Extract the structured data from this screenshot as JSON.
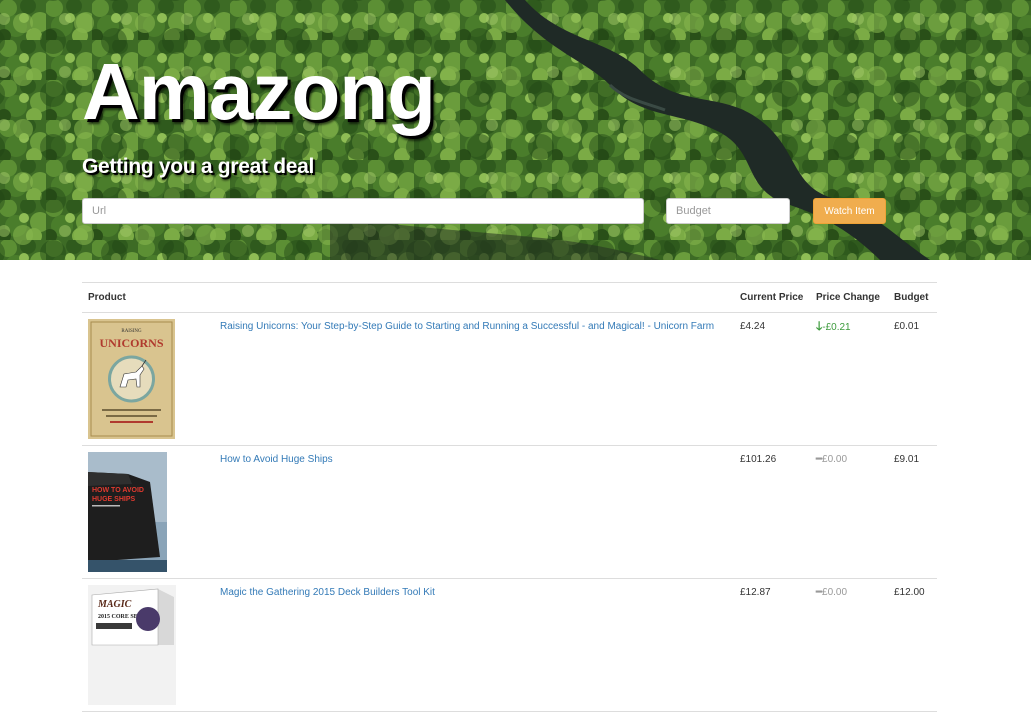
{
  "header": {
    "brand": "Amazong",
    "tagline": "Getting you a great deal"
  },
  "form": {
    "url_placeholder": "Url",
    "budget_placeholder": "Budget",
    "watch_label": "Watch Item",
    "watch_color": "#f0ad4e"
  },
  "table": {
    "headers": {
      "product": "Product",
      "current_price": "Current Price",
      "price_change": "Price Change",
      "budget": "Budget"
    },
    "rows": [
      {
        "title": "Raising Unicorns: Your Step-by-Step Guide to Starting and Running a Successful - and Magical! - Unicorn Farm",
        "price": "£4.24",
        "change": "-£0.21",
        "change_icon": "arrow-down-icon",
        "budget": "£0.01",
        "cover": {
          "line1": "RAISING",
          "line2": "UNICORNS"
        }
      },
      {
        "title": "How to Avoid Huge Ships",
        "price": "£101.26",
        "change": "£0.00",
        "change_icon": "dash-icon",
        "budget": "£9.01",
        "cover": {
          "line1": "HOW TO AVOID",
          "line2": "HUGE SHIPS"
        }
      },
      {
        "title": "Magic the Gathering 2015 Deck Builders Tool Kit",
        "price": "£12.87",
        "change": "£0.00",
        "change_icon": "dash-icon",
        "budget": "£12.00",
        "cover": {
          "line1": "MAGIC",
          "line2": "2015 CORE SET"
        }
      }
    ]
  },
  "colors": {
    "link": "#337ab7",
    "decrease": "#3c9a3c",
    "neutral": "#999999"
  }
}
